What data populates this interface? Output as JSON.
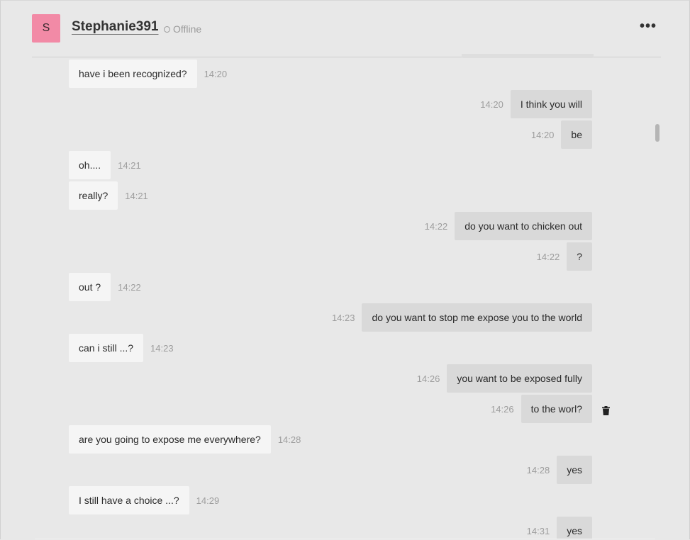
{
  "header": {
    "avatar_letter": "S",
    "username": "Stephanie391",
    "status": "Offline",
    "more_label": "•••"
  },
  "messages": [
    {
      "dir": "in",
      "text": "have i been recognized?",
      "time": "14:20"
    },
    {
      "dir": "out",
      "text": "I think you will",
      "time": "14:20"
    },
    {
      "dir": "out",
      "text": "be",
      "time": "14:20"
    },
    {
      "dir": "in",
      "text": "oh....",
      "time": "14:21"
    },
    {
      "dir": "in",
      "text": "really?",
      "time": "14:21"
    },
    {
      "dir": "out",
      "text": "do you want to chicken out",
      "time": "14:22"
    },
    {
      "dir": "out",
      "text": "?",
      "time": "14:22"
    },
    {
      "dir": "in",
      "text": "out ?",
      "time": "14:22"
    },
    {
      "dir": "out",
      "text": "do you want to stop me expose you to the world",
      "time": "14:23"
    },
    {
      "dir": "in",
      "text": "can i still ...?",
      "time": "14:23"
    },
    {
      "dir": "out",
      "text": "you want to be exposed fully",
      "time": "14:26"
    },
    {
      "dir": "out",
      "text": "to the worl?",
      "time": "14:26"
    },
    {
      "dir": "in",
      "text": "are you going to expose me everywhere?",
      "time": "14:28"
    },
    {
      "dir": "out",
      "text": "yes",
      "time": "14:28"
    },
    {
      "dir": "in",
      "text": "I still have a choice ...?",
      "time": "14:29"
    },
    {
      "dir": "out",
      "text": "yes",
      "time": "14:31"
    }
  ],
  "icons": {
    "delete": "trash-icon",
    "status": "offline-dot-icon",
    "more": "more-horizontal-icon"
  },
  "colors": {
    "avatar": "#f28aa6",
    "incoming_bubble": "#f5f5f5",
    "outgoing_bubble": "#d9d9d9",
    "background": "#e8e8e8"
  }
}
